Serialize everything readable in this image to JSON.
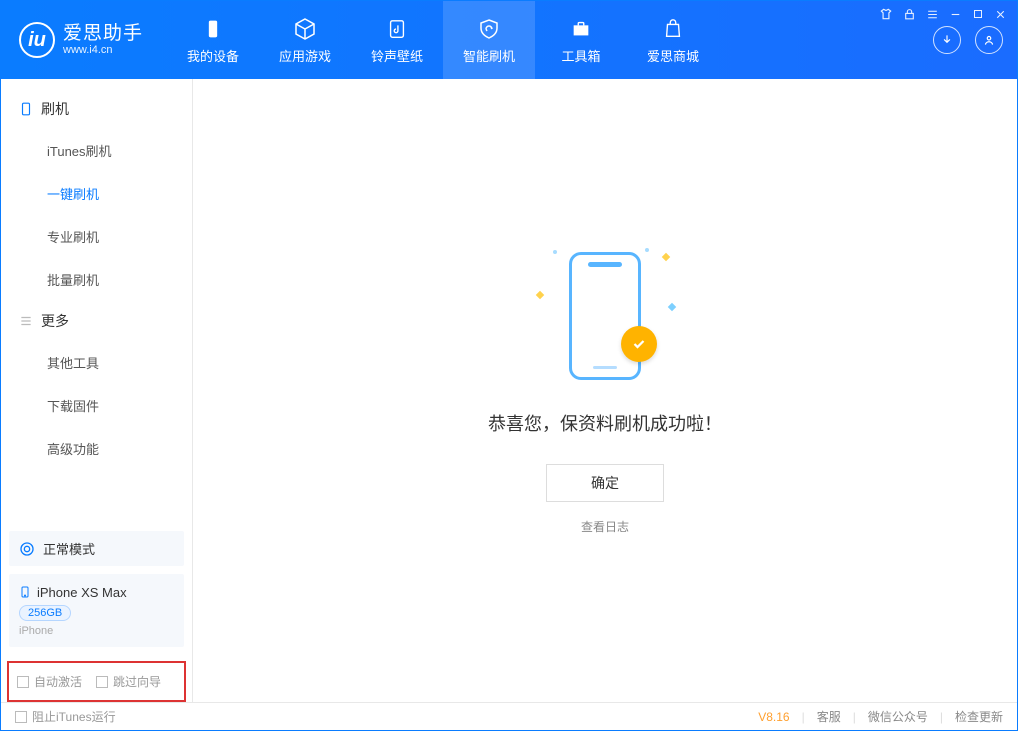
{
  "app": {
    "name": "爱思助手",
    "url": "www.i4.cn"
  },
  "nav": [
    {
      "label": "我的设备"
    },
    {
      "label": "应用游戏"
    },
    {
      "label": "铃声壁纸"
    },
    {
      "label": "智能刷机"
    },
    {
      "label": "工具箱"
    },
    {
      "label": "爱思商城"
    }
  ],
  "sidebar": {
    "group1_title": "刷机",
    "group1": [
      {
        "label": "iTunes刷机"
      },
      {
        "label": "一键刷机"
      },
      {
        "label": "专业刷机"
      },
      {
        "label": "批量刷机"
      }
    ],
    "group2_title": "更多",
    "group2": [
      {
        "label": "其他工具"
      },
      {
        "label": "下载固件"
      },
      {
        "label": "高级功能"
      }
    ],
    "status": "正常模式",
    "device": {
      "name": "iPhone XS Max",
      "storage": "256GB",
      "type": "iPhone"
    },
    "opt1": "自动激活",
    "opt2": "跳过向导"
  },
  "main": {
    "success": "恭喜您，保资料刷机成功啦！",
    "ok": "确定",
    "log": "查看日志"
  },
  "footer": {
    "block_itunes": "阻止iTunes运行",
    "version": "V8.16",
    "service": "客服",
    "wechat": "微信公众号",
    "update": "检查更新"
  }
}
